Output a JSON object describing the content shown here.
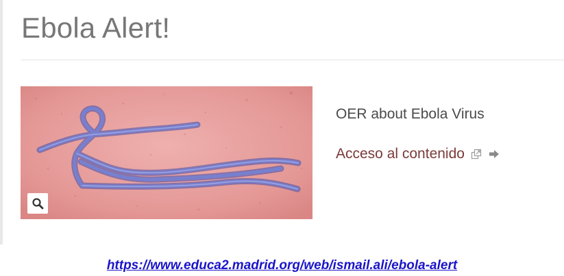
{
  "page": {
    "title": "Ebola Alert!"
  },
  "resource": {
    "image_alt": "Ebola virus",
    "description": "OER about Ebola Virus",
    "access_link_label": "Acceso al contenido",
    "zoom_icon": "magnifier-icon",
    "external_icon": "external-window-icon",
    "arrow_icon": "arrow-right-icon"
  },
  "footer": {
    "url": "https://www.educa2.madrid.org/web/ismail.ali/ebola-alert"
  },
  "colors": {
    "title": "#777777",
    "link": "#7a3a38",
    "url": "#1a14c8",
    "image_background": "#e8a3a3",
    "virus": "#6f78c8"
  }
}
